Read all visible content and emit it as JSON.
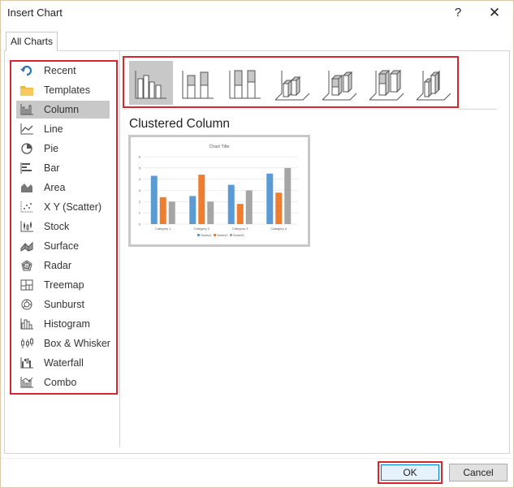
{
  "window": {
    "title": "Insert Chart",
    "help_label": "?",
    "close_label": "✕"
  },
  "tabs": [
    {
      "label": "All Charts"
    }
  ],
  "categories": [
    {
      "label": "Recent",
      "icon": "recent-icon"
    },
    {
      "label": "Templates",
      "icon": "folder-icon"
    },
    {
      "label": "Column",
      "icon": "column-chart-icon"
    },
    {
      "label": "Line",
      "icon": "line-chart-icon"
    },
    {
      "label": "Pie",
      "icon": "pie-chart-icon"
    },
    {
      "label": "Bar",
      "icon": "bar-chart-icon"
    },
    {
      "label": "Area",
      "icon": "area-chart-icon"
    },
    {
      "label": "X Y (Scatter)",
      "icon": "scatter-chart-icon"
    },
    {
      "label": "Stock",
      "icon": "stock-chart-icon"
    },
    {
      "label": "Surface",
      "icon": "surface-chart-icon"
    },
    {
      "label": "Radar",
      "icon": "radar-chart-icon"
    },
    {
      "label": "Treemap",
      "icon": "treemap-chart-icon"
    },
    {
      "label": "Sunburst",
      "icon": "sunburst-chart-icon"
    },
    {
      "label": "Histogram",
      "icon": "histogram-chart-icon"
    },
    {
      "label": "Box & Whisker",
      "icon": "box-whisker-chart-icon"
    },
    {
      "label": "Waterfall",
      "icon": "waterfall-chart-icon"
    },
    {
      "label": "Combo",
      "icon": "combo-chart-icon"
    }
  ],
  "selected_category": "Column",
  "subtypes": [
    {
      "icon": "clustered-column-icon",
      "selected": true
    },
    {
      "icon": "stacked-column-icon"
    },
    {
      "icon": "100-stacked-column-icon"
    },
    {
      "icon": "3d-clustered-column-icon"
    },
    {
      "icon": "3d-stacked-column-icon"
    },
    {
      "icon": "3d-100-stacked-column-icon"
    },
    {
      "icon": "3d-column-icon"
    }
  ],
  "selected_subtype_title": "Clustered Column",
  "preview": {
    "chart_data": {
      "type": "bar",
      "title": "Chart Title",
      "categories": [
        "Category 1",
        "Category 2",
        "Category 3",
        "Category 4"
      ],
      "series": [
        {
          "name": "Series1",
          "values": [
            4.3,
            2.5,
            3.5,
            4.5
          ],
          "color": "#5b9bd5"
        },
        {
          "name": "Series2",
          "values": [
            2.4,
            4.4,
            1.8,
            2.8
          ],
          "color": "#ed7d31"
        },
        {
          "name": "Series3",
          "values": [
            2,
            2,
            3,
            5
          ],
          "color": "#a5a5a5"
        }
      ],
      "ylim": [
        0,
        6
      ],
      "yticks": [
        "0",
        "1",
        "2",
        "3",
        "4",
        "5",
        "6"
      ],
      "grid": true,
      "legend": "bottom"
    }
  },
  "buttons": {
    "ok": "OK",
    "cancel": "Cancel"
  },
  "colors": {
    "highlight": "#d9262e",
    "selected_bg": "#c8c8c8",
    "ok_border": "#0078d7"
  }
}
